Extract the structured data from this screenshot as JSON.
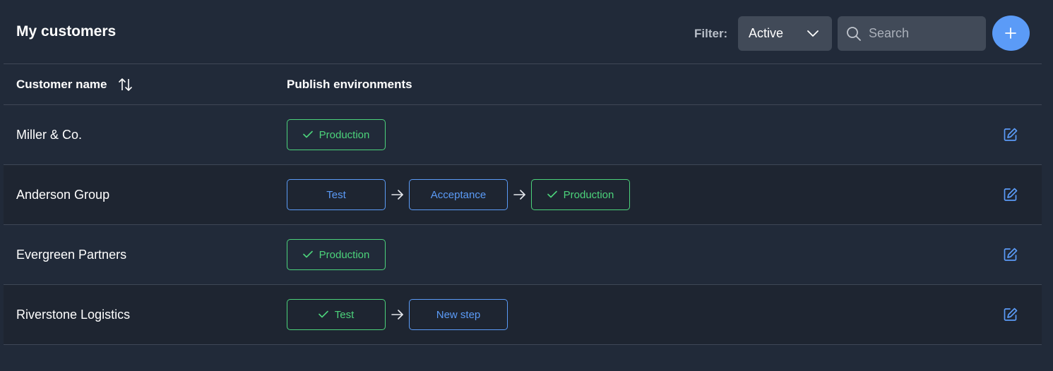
{
  "header": {
    "title": "My customers",
    "filter_label": "Filter:",
    "filter_value": "Active",
    "search_placeholder": "Search"
  },
  "table": {
    "columns": {
      "name": "Customer name",
      "environments": "Publish environments"
    },
    "rows": [
      {
        "name": "Miller & Co.",
        "environments": [
          {
            "label": "Production",
            "status": "done"
          }
        ]
      },
      {
        "name": "Anderson Group",
        "environments": [
          {
            "label": "Test",
            "status": "pending"
          },
          {
            "label": "Acceptance",
            "status": "pending"
          },
          {
            "label": "Production",
            "status": "done"
          }
        ]
      },
      {
        "name": "Evergreen Partners",
        "environments": [
          {
            "label": "Production",
            "status": "done"
          }
        ]
      },
      {
        "name": "Riverstone Logistics",
        "environments": [
          {
            "label": "Test",
            "status": "done"
          },
          {
            "label": "New step",
            "status": "pending"
          }
        ]
      }
    ]
  },
  "colors": {
    "background": "#212a39",
    "done": "#4cd37b",
    "pending": "#5b9bf7",
    "accent": "#5b9bf7"
  },
  "icons": {
    "sort": "sort-arrows-icon",
    "search": "search-icon",
    "add": "plus-icon",
    "edit": "edit-icon",
    "check": "check-icon",
    "arrow": "arrow-right-icon",
    "chevron": "chevron-down-icon"
  }
}
